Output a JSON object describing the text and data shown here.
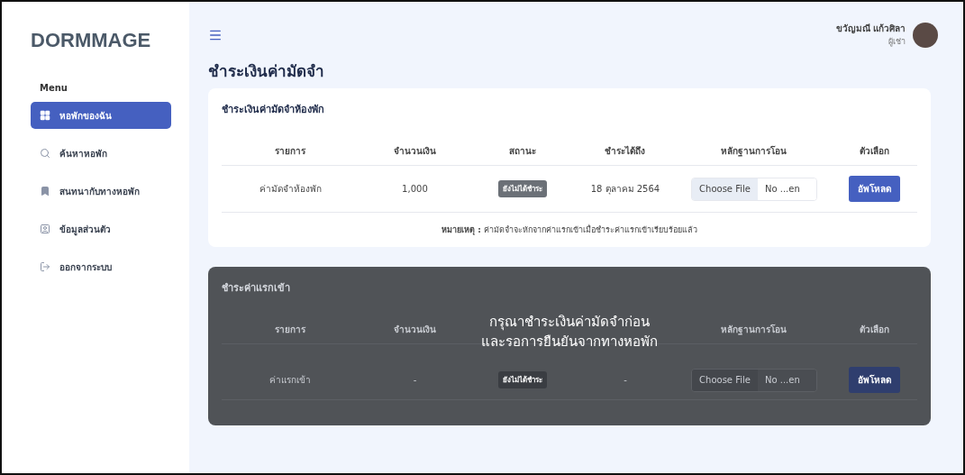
{
  "brand": "DORMMAGE",
  "sidebar": {
    "heading": "Menu",
    "items": [
      {
        "label": "หอพักของฉัน",
        "kind": "grid",
        "selected": true
      },
      {
        "label": "ค้นหาหอพัก",
        "kind": "search",
        "selected": false
      },
      {
        "label": "สนทนากับทางหอพัก",
        "kind": "bookmark",
        "selected": false
      },
      {
        "label": "ข้อมูลส่วนตัว",
        "kind": "person",
        "selected": false
      },
      {
        "label": "ออกจากระบบ",
        "kind": "logout",
        "selected": false
      }
    ]
  },
  "user": {
    "name": "ขวัญมณี แก้วศิลา",
    "role": "ผู้เช่า"
  },
  "page_title": "ชำระเงินค่ามัดจำ",
  "cards": [
    {
      "title": "ชำระเงินค่ามัดจำห้องพัก",
      "locked": false,
      "columns": [
        {
          "label": "รายการ",
          "covered": false
        },
        {
          "label": "จำนวนเงิน",
          "covered": false
        },
        {
          "label": "สถานะ",
          "covered": false
        },
        {
          "label": "ชำระได้ถึง",
          "covered": false
        },
        {
          "label": "หลักฐานการโอน",
          "covered": false
        },
        {
          "label": "ตัวเลือก",
          "covered": false
        }
      ],
      "row": {
        "item": "ค่ามัดจำห้องพัก",
        "amount": "1,000",
        "status": "ยังไม่ได้ชำระ",
        "due": "18 ตุลาคม 2564",
        "file_button": "Choose File",
        "file_name": "No ...en",
        "action": "อัพโหลด"
      },
      "note": "**หมายเหตุ :** ค่ามัดจำจะหักจากค่าแรกเข้าเมื่อชำระค่าแรกเข้าเรียบร้อยแล้ว"
    },
    {
      "title": "ชำระค่าแรกเข้า",
      "locked": true,
      "columns": [
        {
          "label": "รายการ",
          "covered": false
        },
        {
          "label": "จำนวนเงิน",
          "covered": false
        },
        {
          "covered": true
        },
        {
          "covered": true
        },
        {
          "label": "หลักฐานการโอน",
          "covered": false
        },
        {
          "label": "ตัวเลือก",
          "covered": false
        }
      ],
      "row": {
        "item": "ค่าแรกเข้า",
        "amount": "-",
        "status": "ยังไม่ได้ชำระ",
        "due": "-",
        "file_button": "Choose File",
        "file_name": "No ...en",
        "action": "อัพโหลด"
      },
      "overlay_lines": [
        "กรุณาชำระเงินค่ามัดจำก่อน",
        "และรอการยืนยันจากทางหอพัก"
      ]
    }
  ]
}
